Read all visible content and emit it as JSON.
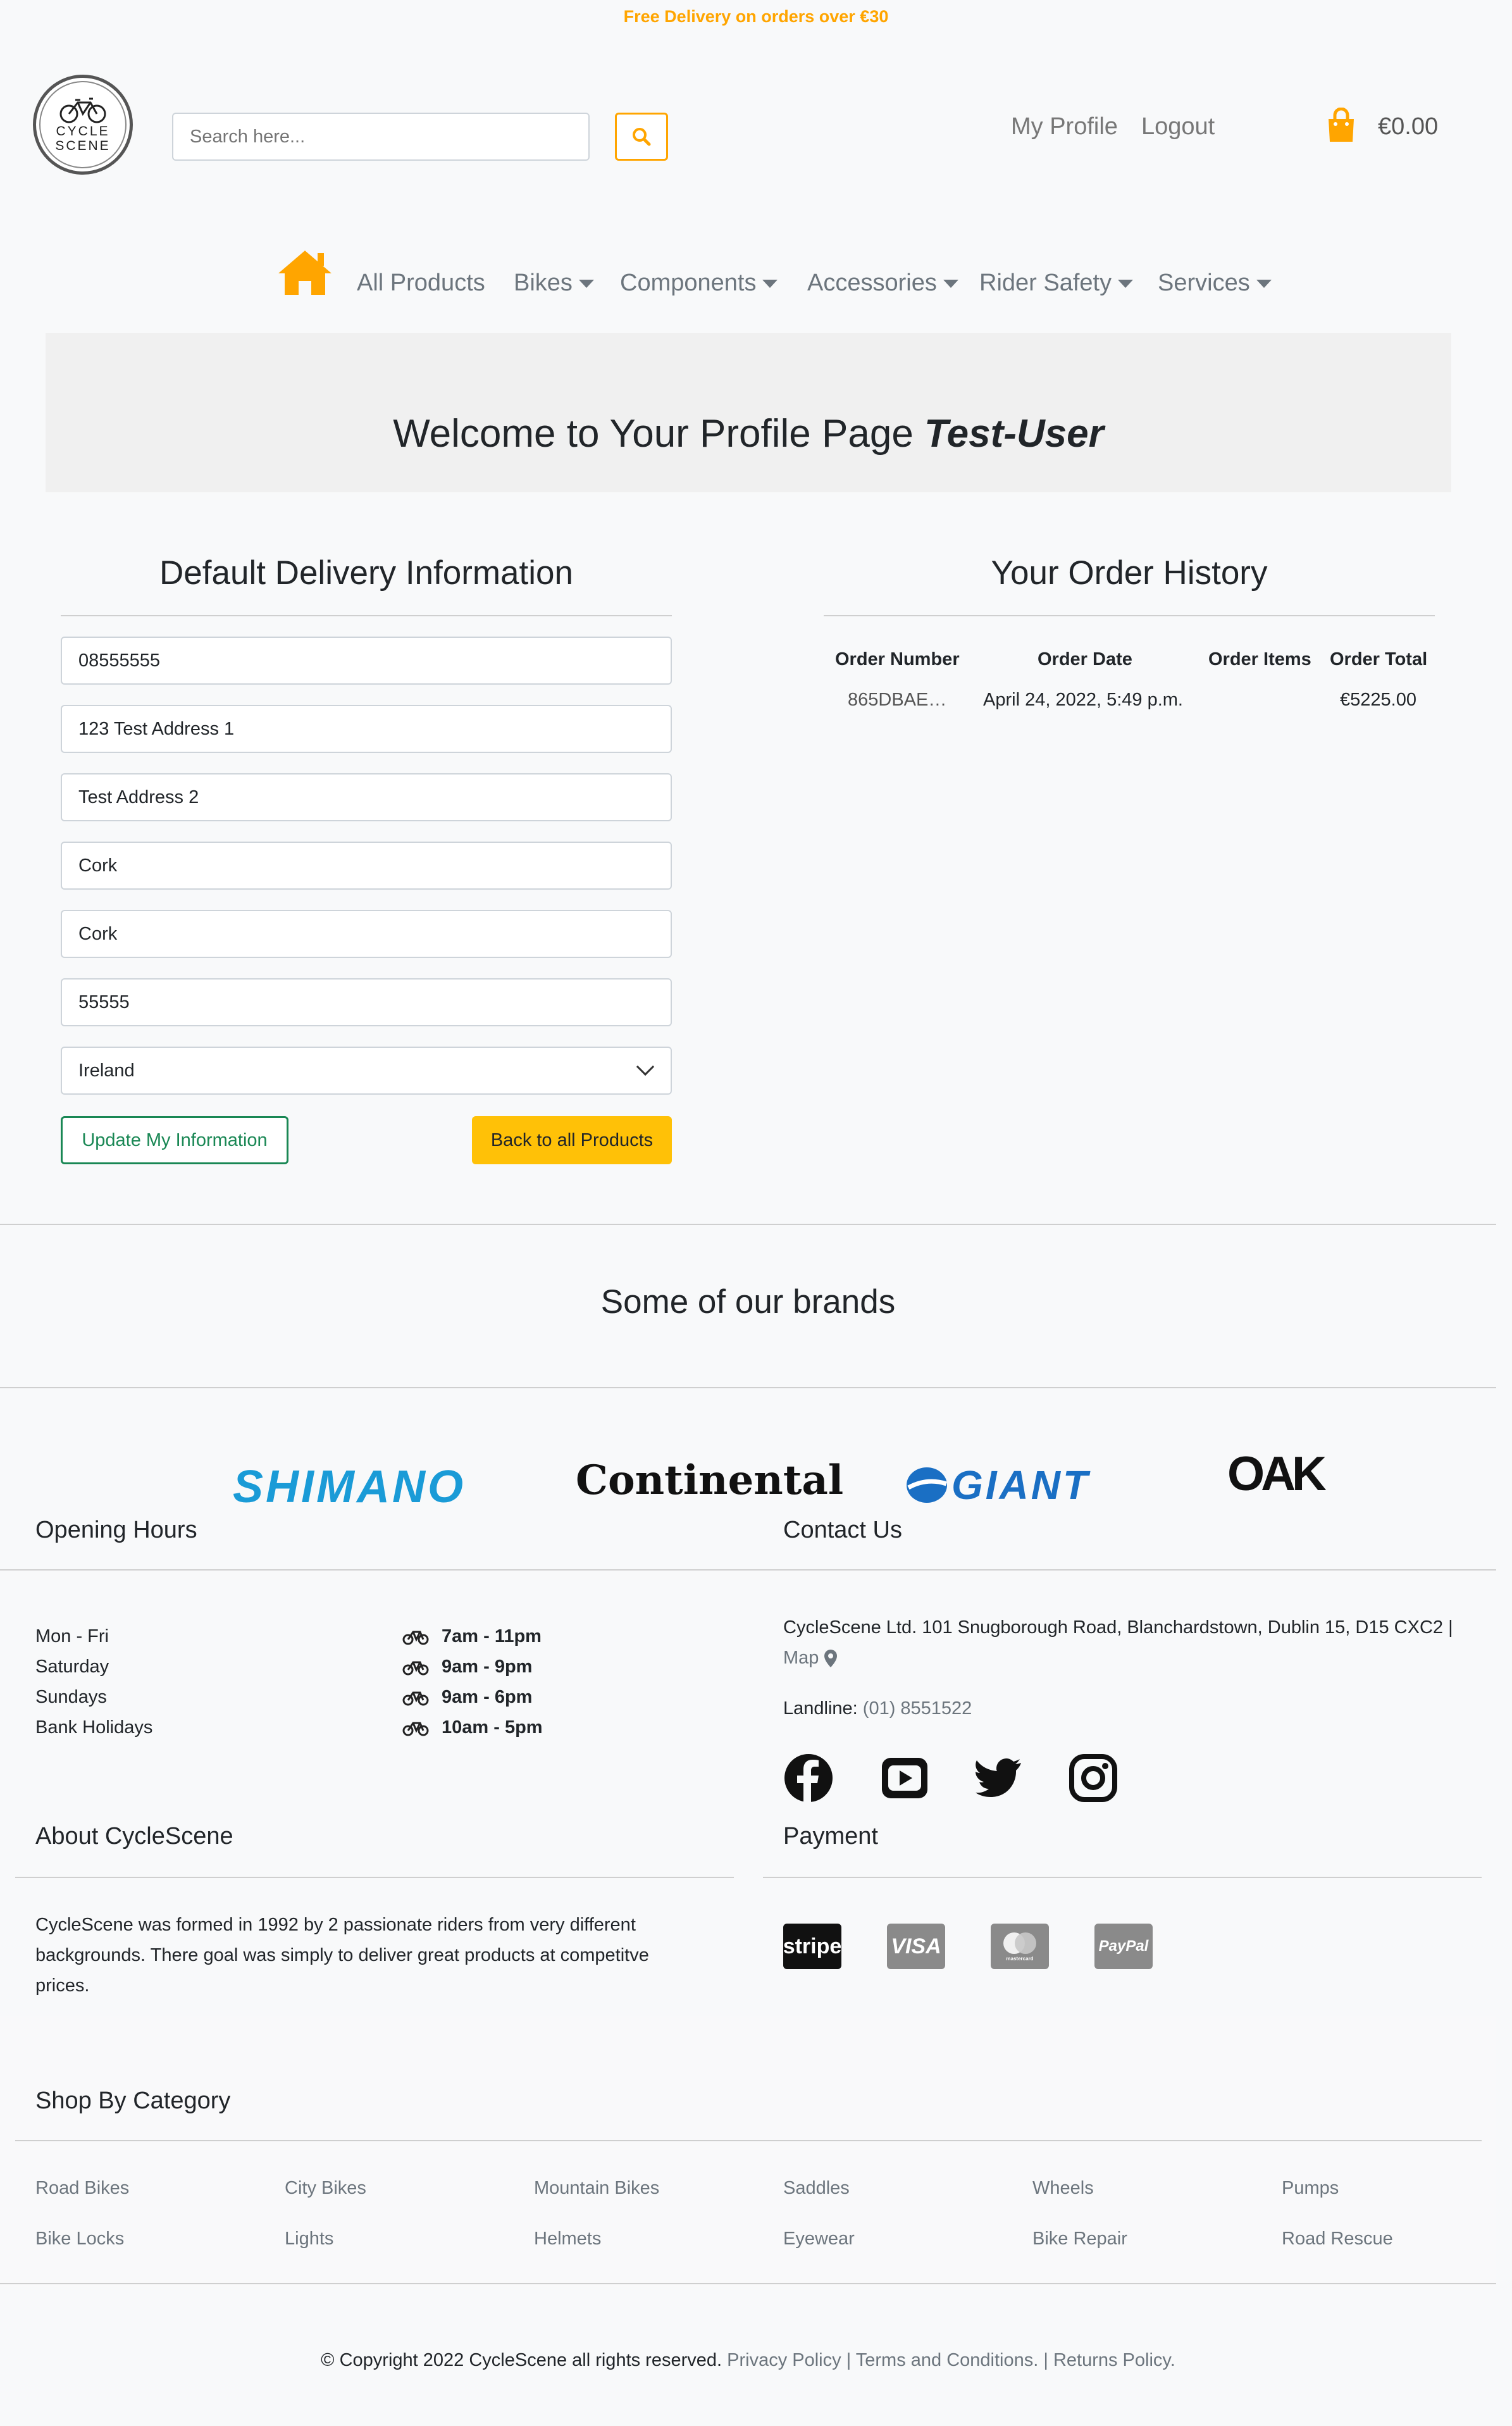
{
  "banner": {
    "text": "Free Delivery on orders over €30"
  },
  "header": {
    "logo_line1": "CYCLE",
    "logo_line2": "SCENE",
    "search_placeholder": "Search here...",
    "my_profile": "My Profile",
    "logout": "Logout",
    "cart_total": "€0.00"
  },
  "nav": {
    "items": [
      {
        "label": "All Products",
        "dropdown": false
      },
      {
        "label": "Bikes",
        "dropdown": true
      },
      {
        "label": "Components",
        "dropdown": true
      },
      {
        "label": "Accessories",
        "dropdown": true
      },
      {
        "label": "Rider Safety",
        "dropdown": true
      },
      {
        "label": "Services",
        "dropdown": true
      }
    ]
  },
  "welcome": {
    "text": "Welcome to Your Profile Page",
    "username": "Test-User"
  },
  "delivery": {
    "title": "Default Delivery Information",
    "fields": [
      "08555555",
      "123 Test Address 1",
      "Test Address 2",
      "Cork",
      "Cork",
      "55555"
    ],
    "country": "Ireland",
    "update_button": "Update My Information",
    "back_button": "Back to all Products"
  },
  "orders": {
    "title": "Your Order History",
    "headers": [
      "Order Number",
      "Order Date",
      "Order Items",
      "Order Total"
    ],
    "rows": [
      {
        "number": "865DBAE…",
        "date": "April 24, 2022, 5:49 p.m.",
        "items": "",
        "total": "€5225.00"
      }
    ]
  },
  "brands": {
    "title": "Some of our brands",
    "logos": [
      "SHIMANO",
      "Continental",
      "GIANT",
      "OAK"
    ]
  },
  "opening_hours": {
    "title": "Opening Hours",
    "rows": [
      {
        "day": "Mon - Fri",
        "time": "7am - 11pm"
      },
      {
        "day": "Saturday",
        "time": "9am - 9pm"
      },
      {
        "day": "Sundays",
        "time": "9am - 6pm"
      },
      {
        "day": "Bank Holidays",
        "time": "10am - 5pm"
      }
    ]
  },
  "contact": {
    "title": "Contact Us",
    "address": "CycleScene Ltd. 101 Snugborough Road, Blanchardstown, Dublin 15, D15 CXC2 |",
    "map": "Map",
    "landline_label": "Landline:",
    "landline": "(01) 8551522"
  },
  "about": {
    "title": "About CycleScene",
    "text": "CycleScene was formed in 1992 by 2 passionate riders from very different backgrounds. There goal was simply to deliver great products at competitve prices."
  },
  "payment": {
    "title": "Payment",
    "methods": [
      "stripe",
      "VISA",
      "mastercard",
      "PayPal"
    ]
  },
  "categories": {
    "title": "Shop By Category",
    "row1": [
      "Road Bikes",
      "City Bikes",
      "Mountain Bikes",
      "Saddles",
      "Wheels",
      "Pumps"
    ],
    "row2": [
      "Bike Locks",
      "Lights",
      "Helmets",
      "Eyewear",
      "Bike Repair",
      "Road Rescue"
    ]
  },
  "footer": {
    "copyright": "© Copyright 2022 CycleScene all rights reserved.",
    "privacy": "Privacy Policy",
    "terms": "Terms and Conditions.",
    "returns": "Returns Policy."
  },
  "colors": {
    "accent": "#ffa500",
    "primary_button": "#ffc107",
    "success": "#198754"
  }
}
